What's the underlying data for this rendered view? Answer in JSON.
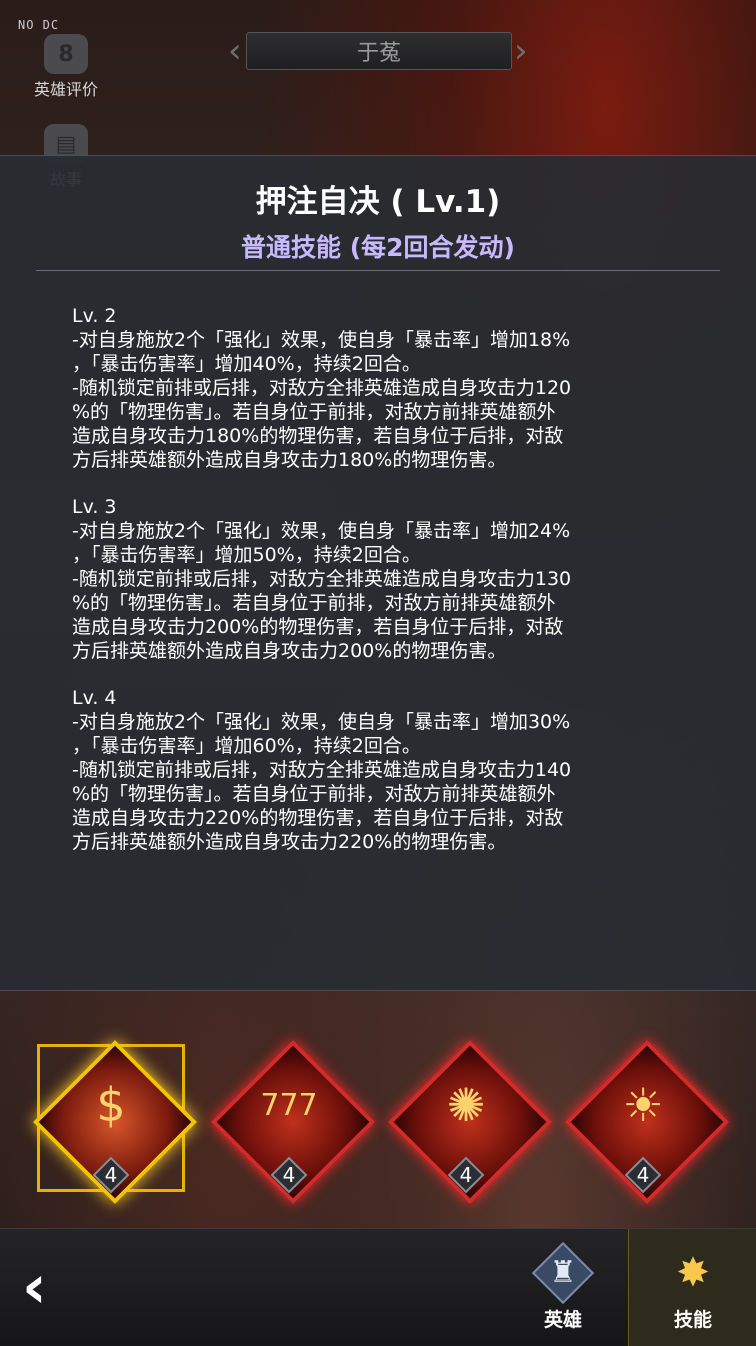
{
  "top_tag": "NO DC",
  "side_buttons": [
    {
      "label": "英雄评价",
      "icon": "chat-bubble-icon"
    },
    {
      "label": "故事",
      "icon": "book-icon"
    }
  ],
  "hero_name": "于菟",
  "skill_panel": {
    "title": "押注自决 ( Lv.1)",
    "subtitle": "普通技能 (每2回合发动)",
    "levels": [
      {
        "level": "Lv. 2",
        "lines": [
          "-对自身施放2个「强化」效果，使自身「暴击率」增加18%",
          "，「暴击伤害率」增加40%，持续2回合。",
          "-随机锁定前排或后排，对敌方全排英雄造成自身攻击力120",
          "%的「物理伤害」。若自身位于前排，对敌方前排英雄额外",
          "造成自身攻击力180%的物理伤害，若自身位于后排，对敌",
          "方后排英雄额外造成自身攻击力180%的物理伤害。"
        ]
      },
      {
        "level": "Lv. 3",
        "lines": [
          "-对自身施放2个「强化」效果，使自身「暴击率」增加24%",
          "，「暴击伤害率」增加50%，持续2回合。",
          "-随机锁定前排或后排，对敌方全排英雄造成自身攻击力130",
          "%的「物理伤害」。若自身位于前排，对敌方前排英雄额外",
          "造成自身攻击力200%的物理伤害，若自身位于后排，对敌",
          "方后排英雄额外造成自身攻击力200%的物理伤害。"
        ]
      },
      {
        "level": "Lv. 4",
        "lines": [
          "-对自身施放2个「强化」效果，使自身「暴击率」增加30%",
          "，「暴击伤害率」增加60%，持续2回合。",
          "-随机锁定前排或后排，对敌方全排英雄造成自身攻击力140",
          "%的「物理伤害」。若自身位于前排，对敌方前排英雄额外",
          "造成自身攻击力220%的物理伤害，若自身位于后排，对敌",
          "方后排英雄额外造成自身攻击力220%的物理伤害。"
        ]
      }
    ]
  },
  "skills": [
    {
      "icon": "coins-icon",
      "glyph": "$",
      "level": "4",
      "selected": true
    },
    {
      "icon": "slot-machine-icon",
      "glyph": "777",
      "level": "4",
      "selected": false
    },
    {
      "icon": "whisk-bowl-icon",
      "glyph": "✺",
      "level": "4",
      "selected": false
    },
    {
      "icon": "tiger-face-icon",
      "glyph": "☀",
      "level": "4",
      "selected": false
    }
  ],
  "bottom_nav": {
    "back_icon": "back-arrow-icon",
    "hero_label": "英雄",
    "skill_label": "技能",
    "active": "技能"
  },
  "colors": {
    "panel_bg": "#282c32",
    "subtitle": "#c7b9ff",
    "skill_border": "#d42a2a",
    "selected_border": "#f5c400"
  }
}
